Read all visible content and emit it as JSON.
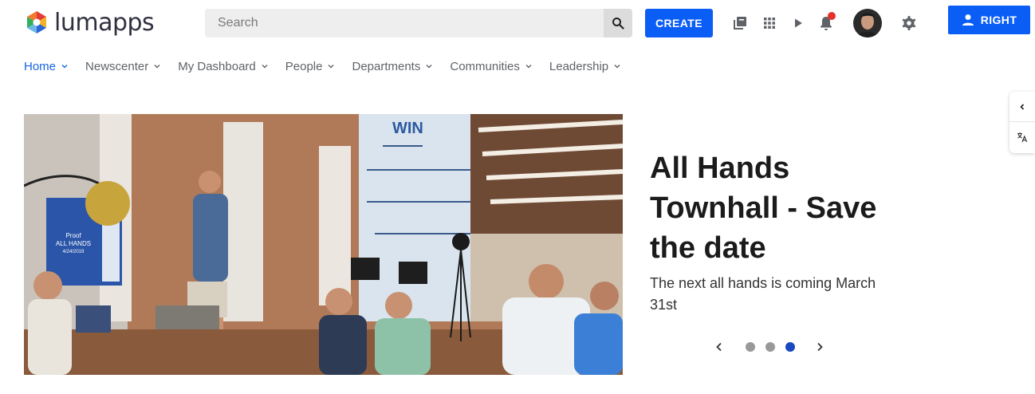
{
  "brand": {
    "name": "lumapps"
  },
  "header": {
    "search_placeholder": "Search",
    "create_label": "CREATE",
    "right_label": "RIGHT",
    "accent_color": "#0b5ef5",
    "notification_dot_color": "#e8302a",
    "icons": [
      "search-icon",
      "library-icon",
      "apps-grid-icon",
      "play-icon",
      "bell-icon",
      "user-avatar",
      "gear-icon",
      "person-icon"
    ]
  },
  "nav": {
    "items": [
      {
        "label": "Home",
        "active": true
      },
      {
        "label": "Newscenter",
        "active": false
      },
      {
        "label": "My Dashboard",
        "active": false
      },
      {
        "label": "People",
        "active": false
      },
      {
        "label": "Departments",
        "active": false
      },
      {
        "label": "Communities",
        "active": false
      },
      {
        "label": "Leadership",
        "active": false
      }
    ]
  },
  "hero": {
    "image_screen": {
      "line1": "Proof",
      "line2": "ALL HANDS",
      "line3": "4/24/2019"
    },
    "wall_sign": "WIN",
    "title": "All Hands Townhall - Save the date",
    "subtitle": "The next all hands is coming March 31st",
    "carousel": {
      "slide_count": 3,
      "active_index": 2
    }
  },
  "side_panel": {
    "icons": [
      "chevron-left-icon",
      "translate-icon"
    ]
  }
}
